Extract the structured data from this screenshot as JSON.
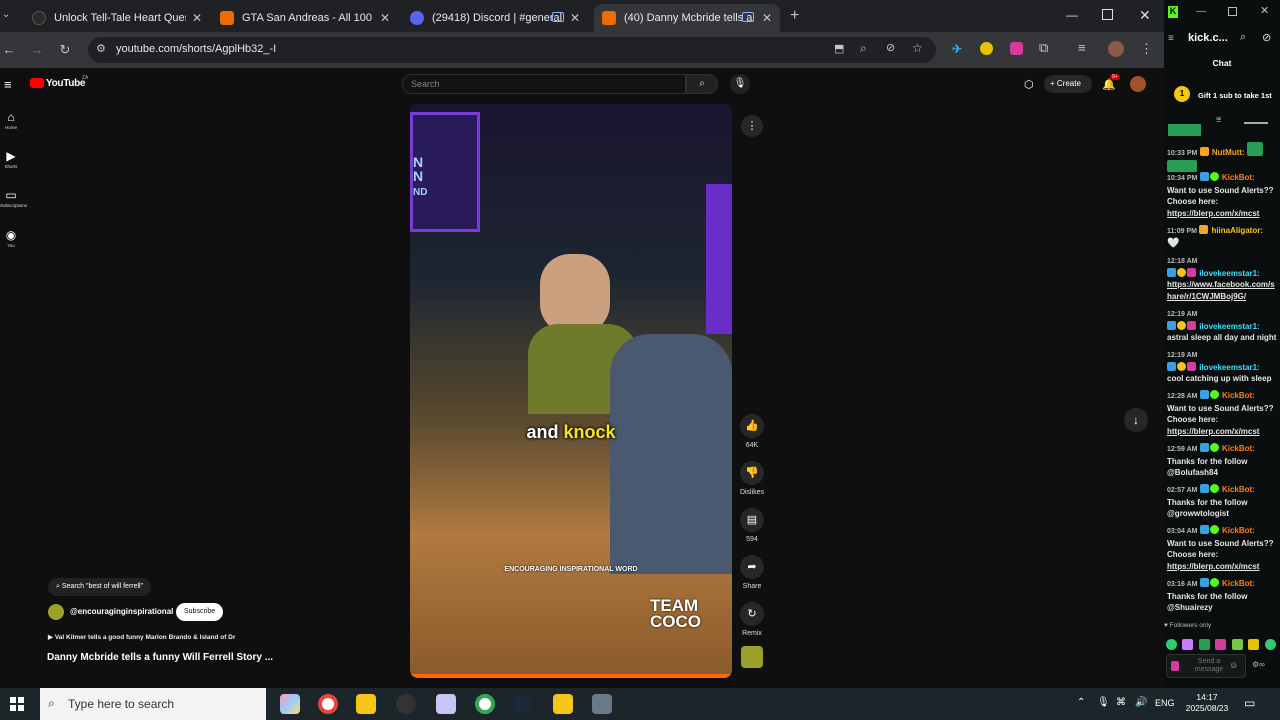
{
  "tabs": [
    {
      "title": "Unlock Tell-Tale Heart Quest",
      "color": "#2b2b2b"
    },
    {
      "title": "GTA San Andreas - All 100 Tag",
      "color": "#ef6c00"
    },
    {
      "title": "(29418) Discord | #general",
      "color": "#5865f2"
    },
    {
      "title": "(40) Danny Mcbride tells a",
      "color": "#ef6c00"
    }
  ],
  "browser": {
    "url": "youtube.com/shorts/AgplHb32_-I",
    "new_tab": "+"
  },
  "youtube": {
    "logo": "YouTube",
    "logo_region": "ZA",
    "search_placeholder": "Search",
    "create_label": "Create",
    "notifications_badge": "9+",
    "rail": [
      {
        "icon": "home-icon",
        "label": "Home"
      },
      {
        "icon": "shorts-icon",
        "label": "Shorts"
      },
      {
        "icon": "subscriptions-icon",
        "label": "Subscriptions"
      },
      {
        "icon": "you-icon",
        "label": "You"
      }
    ],
    "caption": "and knock",
    "caption_highlight": "knock",
    "watermark_small": "ENCOURAGING INSPIRATIONAL WORD",
    "watermark_team": "TEAM",
    "watermark_coco": "COCO",
    "search_chip": "Search \"best of will ferrell\"",
    "channel": "@encouraginginspirational",
    "subscribe_label": "Subscribe",
    "playlist_line": "Val Kilmer tells a good funny Marlon Brando & Island of Dr",
    "video_title": "Danny Mcbride tells a funny Will Ferrell Story ...",
    "actions": [
      {
        "icon": "like-icon",
        "label": "64K"
      },
      {
        "icon": "dislike-icon",
        "label": "Dislikes"
      },
      {
        "icon": "comment-icon",
        "label": "594"
      },
      {
        "icon": "share-icon",
        "label": "Share"
      },
      {
        "icon": "remix-icon",
        "label": "Remix"
      }
    ]
  },
  "kick": {
    "site": "kick.c...",
    "chat_title": "Chat",
    "gift_count": "1",
    "gift_text": "Gift 1 sub to take 1st",
    "messages": [
      {
        "time": "10:33 PM",
        "user": "NutMutt:",
        "user_color": "#f5a623",
        "text": ""
      },
      {
        "time": "10:34 PM",
        "user": "KickBot:",
        "user_color": "#ff7a1a",
        "text": "Want to use Sound Alerts?? Choose here:",
        "link": "https://blerp.com/x/mcst"
      },
      {
        "time": "11:09 PM",
        "user": "hiinaAligator:",
        "user_color": "#f5c518",
        "text": ""
      },
      {
        "time": "12:18 AM",
        "user": "ilovekeemstar1:",
        "user_color": "#3be0ff",
        "text": "",
        "link": "https://www.facebook.com/share/r/1CWJMBoj9G/"
      },
      {
        "time": "12:19 AM",
        "user": "ilovekeemstar1:",
        "user_color": "#3be0ff",
        "text": "astral sleep all day and night"
      },
      {
        "time": "12:19 AM",
        "user": "ilovekeemstar1:",
        "user_color": "#3be0ff",
        "text": "cool catching up with sleep"
      },
      {
        "time": "12:28 AM",
        "user": "KickBot:",
        "user_color": "#ff7a1a",
        "text": "Want to use Sound Alerts?? Choose here:",
        "link": "https://blerp.com/x/mcst"
      },
      {
        "time": "12:59 AM",
        "user": "KickBot:",
        "user_color": "#ff7a1a",
        "text": "Thanks for the follow @Bolufash84"
      },
      {
        "time": "02:57 AM",
        "user": "KickBot:",
        "user_color": "#ff7a1a",
        "text": "Thanks for the follow @growwtologist"
      },
      {
        "time": "03:04 AM",
        "user": "KickBot:",
        "user_color": "#ff7a1a",
        "text": "Want to use Sound Alerts?? Choose here:",
        "link": "https://blerp.com/x/mcst"
      },
      {
        "time": "03:16 AM",
        "user": "KickBot:",
        "user_color": "#ff7a1a",
        "text": "Thanks for the follow @Shuairezy"
      }
    ],
    "followers_only": "Followers only",
    "send_placeholder": "Send a message"
  },
  "taskbar": {
    "search_placeholder": "Type here to search",
    "lang": "ENG",
    "time": "14:17",
    "date": "2025/08/23"
  }
}
